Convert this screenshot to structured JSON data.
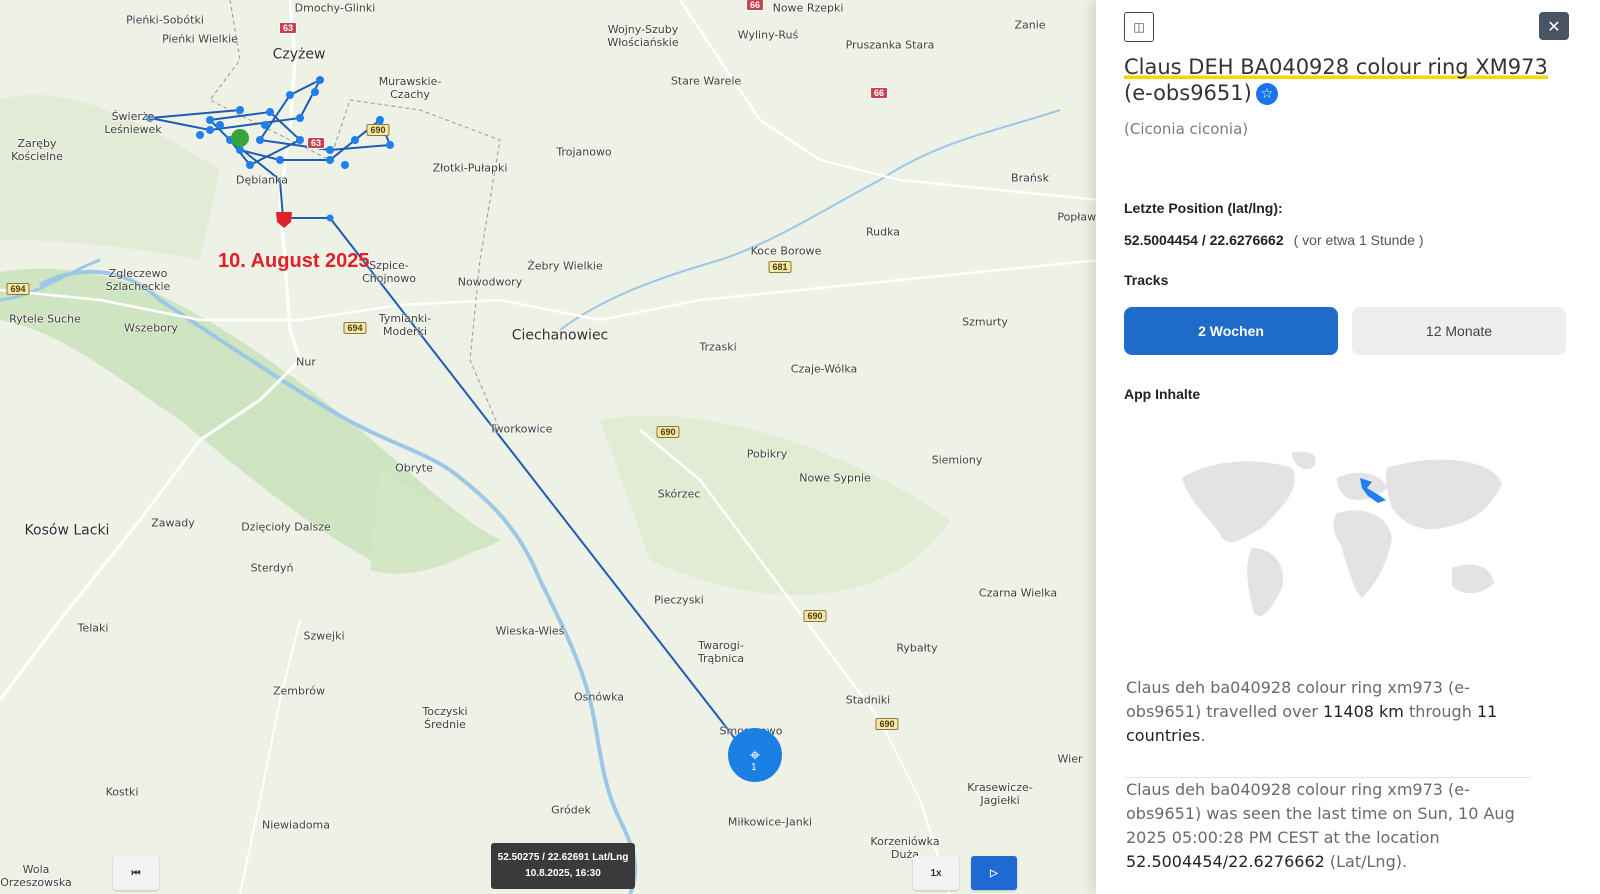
{
  "map": {
    "annotation": "10. August 2025",
    "places": [
      {
        "name": "Dmochy-Glinki"
      },
      {
        "name": "Pieńki-Sobótki"
      },
      {
        "name": "Pieńki Wielkie"
      },
      {
        "name": "Czyżew"
      },
      {
        "name": "Murawskie-Czachy"
      },
      {
        "name": "Świerże Leśniewek"
      },
      {
        "name": "Zaręby Kościelne"
      },
      {
        "name": "Dębianka"
      },
      {
        "name": "Złotki-Pułapki"
      },
      {
        "name": "Wojny-Szuby Włościańskie"
      },
      {
        "name": "Wyliny-Ruś"
      },
      {
        "name": "Nowe Rzepki"
      },
      {
        "name": "Pruszanka Stara"
      },
      {
        "name": "Zanie"
      },
      {
        "name": "Stare Warele"
      },
      {
        "name": "Trojanowo"
      },
      {
        "name": "Brańsk"
      },
      {
        "name": "Popławy"
      },
      {
        "name": "Rudka"
      },
      {
        "name": "Koce Borowe"
      },
      {
        "name": "Żebry Wielkie"
      },
      {
        "name": "Szpice-Chojnowo"
      },
      {
        "name": "Nowodwory"
      },
      {
        "name": "Zgleczewo Szlacheckie"
      },
      {
        "name": "Rytele Suche"
      },
      {
        "name": "Wszebory"
      },
      {
        "name": "Tymianki-Moderki"
      },
      {
        "name": "Ciechanowiec"
      },
      {
        "name": "Trzaski"
      },
      {
        "name": "Czaje-Wólka"
      },
      {
        "name": "Szmurty"
      },
      {
        "name": "Nur"
      },
      {
        "name": "Tworkowice"
      },
      {
        "name": "Pobikry"
      },
      {
        "name": "Nowe Sypnie"
      },
      {
        "name": "Siemiony"
      },
      {
        "name": "Obryte"
      },
      {
        "name": "Skórzec"
      },
      {
        "name": "Kosów Lacki"
      },
      {
        "name": "Zawady"
      },
      {
        "name": "Dzięcioły Dalsze"
      },
      {
        "name": "Sterdyń"
      },
      {
        "name": "Pieczyski"
      },
      {
        "name": "Czarna Wielka"
      },
      {
        "name": "Telaki"
      },
      {
        "name": "Szwejki"
      },
      {
        "name": "Wieska-Wieś"
      },
      {
        "name": "Twarogi-Trąbnica"
      },
      {
        "name": "Rybałty"
      },
      {
        "name": "Zembrów"
      },
      {
        "name": "Osnówka"
      },
      {
        "name": "Toczyski Średnie"
      },
      {
        "name": "Smorczewo"
      },
      {
        "name": "Stadniki"
      },
      {
        "name": "Kostki"
      },
      {
        "name": "Gródek"
      },
      {
        "name": "Krasewicze-Jagiełki"
      },
      {
        "name": "Niewiadoma"
      },
      {
        "name": "Miłkowice-Janki"
      },
      {
        "name": "Korzeniówka Duża"
      },
      {
        "name": "Wola Orzeszowska"
      },
      {
        "name": "Wier"
      }
    ],
    "road_labels": [
      "63",
      "66",
      "66",
      "63",
      "690",
      "694",
      "694",
      "681",
      "690",
      "690",
      "690"
    ],
    "tooltip": {
      "line1": "52.50275 / 22.62691 Lat/Lng",
      "line2": "10.8.2025, 16:30"
    },
    "current_count": "1",
    "speed_label": "1x",
    "icons": {
      "rewind": "skip-back-icon",
      "play": "play-icon",
      "locate": "crosshair-icon"
    }
  },
  "panel": {
    "title_highlight": "Claus DEH BA040928 colour ring XM973",
    "title_rest": " (e-obs9651)",
    "scientific": "(Ciconia ciconia)",
    "last_position_label": "Letzte Position (lat/lng):",
    "last_position_value": "52.5004454 / 22.6276662",
    "last_position_ago": "( vor etwa 1 Stunde )",
    "tracks_label": "Tracks",
    "tab_2w": "2 Wochen",
    "tab_12m": "12 Monate",
    "app_label": "App Inhalte",
    "summary1": {
      "pre": "Claus deh ba040928 colour ring xm973 (e-obs9651) travelled over ",
      "km": "11408 km",
      "mid": " through ",
      "countries": "11 countries",
      "end": "."
    },
    "summary2": {
      "pre": "Claus deh ba040928 colour ring xm973 (e-obs9651) was seen the last time on Sun, 10 Aug 2025 05:00:28 PM CEST at the location ",
      "loc": "52.5004454/22.6276662",
      "end": " (Lat/Lng)."
    }
  }
}
